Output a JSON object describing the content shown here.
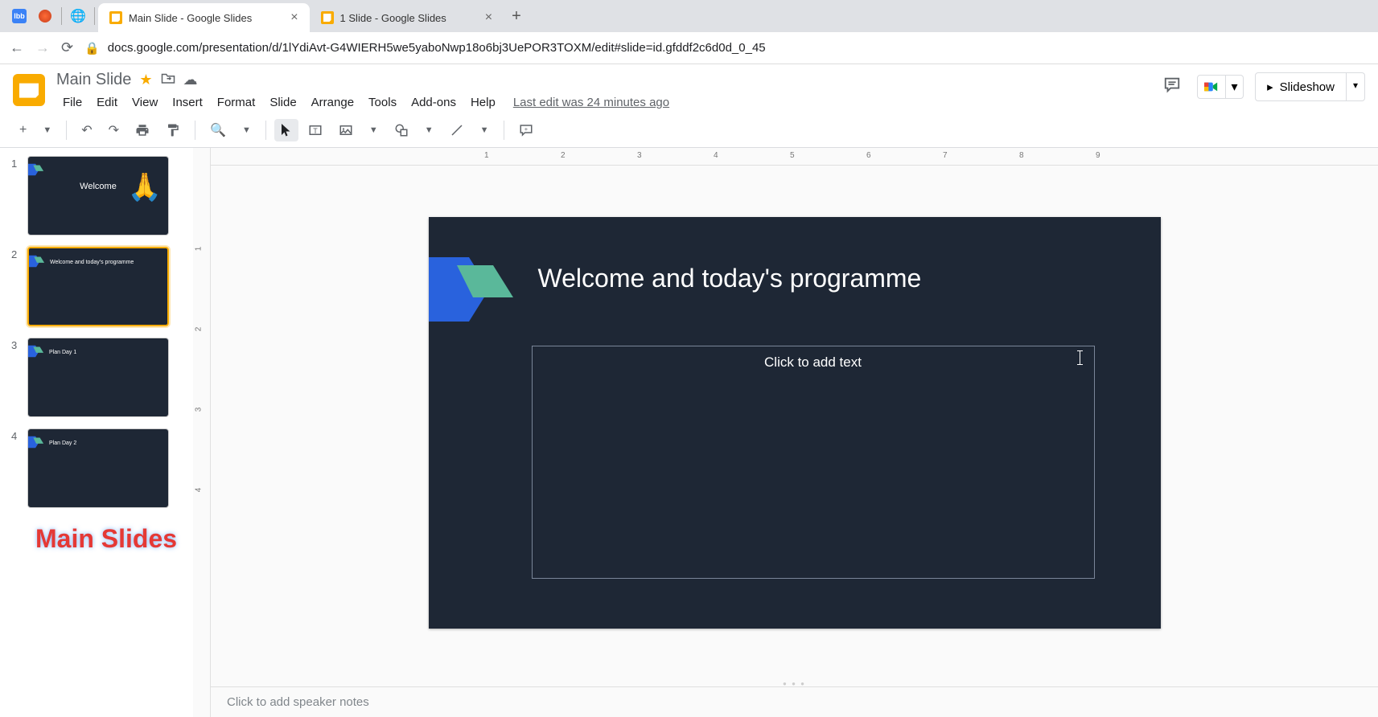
{
  "browser": {
    "tabs": [
      {
        "title": "Main Slide - Google Slides"
      },
      {
        "title": "1 Slide - Google Slides"
      }
    ]
  },
  "addressbar": {
    "url": "docs.google.com/presentation/d/1lYdiAvt-G4WIERH5we5yaboNwp18o6bj3UePOR3TOXM/edit#slide=id.gfddf2c6d0d_0_45",
    "host": "docs.google.com"
  },
  "header": {
    "doc_title": "Main Slide",
    "menus": [
      "File",
      "Edit",
      "View",
      "Insert",
      "Format",
      "Slide",
      "Arrange",
      "Tools",
      "Add-ons",
      "Help"
    ],
    "last_edit": "Last edit was 24 minutes ago",
    "slideshow_label": "Slideshow"
  },
  "ruler_h": [
    "1",
    "2",
    "3",
    "4",
    "5",
    "6",
    "7",
    "8",
    "9"
  ],
  "ruler_v": [
    "1",
    "2",
    "3",
    "4"
  ],
  "thumbnails": [
    {
      "num": "1",
      "title": "Welcome",
      "center": true
    },
    {
      "num": "2",
      "title": "Welcome and today's programme",
      "selected": true
    },
    {
      "num": "3",
      "title": "Plan Day 1"
    },
    {
      "num": "4",
      "title": "Plan Day 2"
    }
  ],
  "annotation": "Main Slides",
  "slide": {
    "title": "Welcome and today's programme",
    "body_placeholder": "Click to add text"
  },
  "notes": {
    "placeholder": "Click to add speaker notes"
  }
}
